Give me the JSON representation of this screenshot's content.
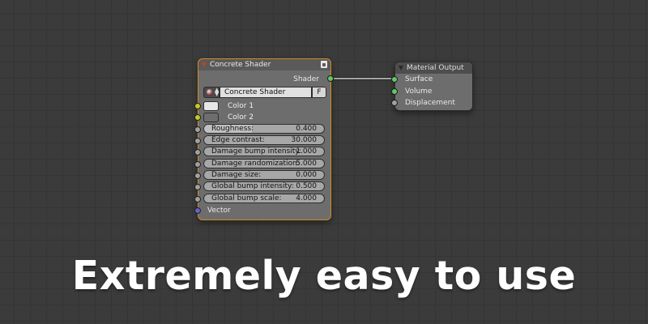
{
  "shader_node": {
    "title": "Concrete Shader",
    "output_label": "Shader",
    "node_tree": {
      "name": "Concrete Shader",
      "fake_user": "F"
    },
    "colors": [
      {
        "label": "Color 1",
        "swatch": "#e6e6e6"
      },
      {
        "label": "Color 2",
        "swatch": "#6d6d6d"
      }
    ],
    "params": [
      {
        "label": "Roughness:",
        "value": "0.400",
        "fill": 0.4
      },
      {
        "label": "Edge contrast:",
        "value": "30.000",
        "fill": 0.0
      },
      {
        "label": "Damage bump intensity:",
        "value": "1.000",
        "fill": 0.0
      },
      {
        "label": "Damage randomization:",
        "value": "5.000",
        "fill": 0.0
      },
      {
        "label": "Damage size:",
        "value": "0.000",
        "fill": 0.0
      },
      {
        "label": "Global bump intensity:",
        "value": "0.500",
        "fill": 0.0
      },
      {
        "label": "Global bump scale:",
        "value": "4.000",
        "fill": 0.0
      }
    ],
    "vector_label": "Vector"
  },
  "output_node": {
    "title": "Material Output",
    "inputs": [
      "Surface",
      "Volume",
      "Displacement"
    ]
  },
  "socket_colors": {
    "shader": "#63c763",
    "color": "#c7c729",
    "float": "#a1a1a1",
    "vector": "#6363c7"
  },
  "tagline": "Extremely easy to use"
}
